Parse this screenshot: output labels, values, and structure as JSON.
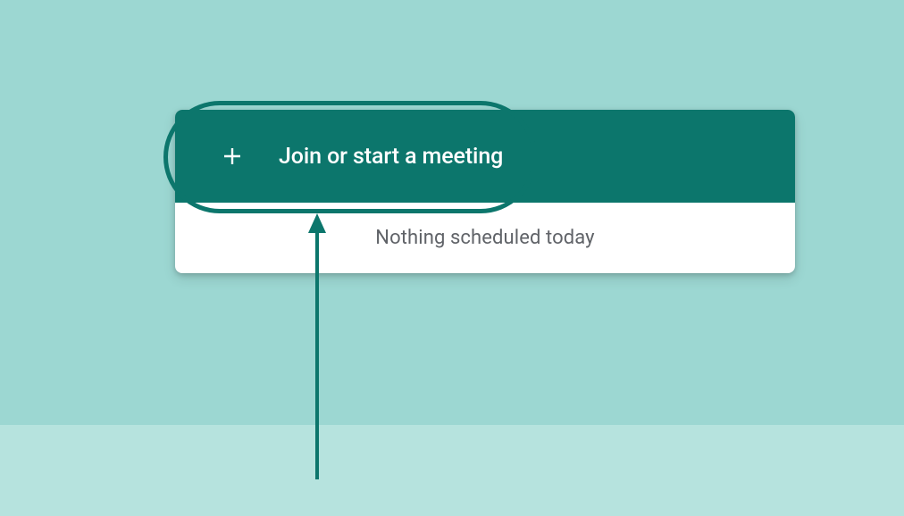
{
  "button": {
    "label": "Join or start a meeting"
  },
  "schedule": {
    "status": "Nothing scheduled today"
  }
}
